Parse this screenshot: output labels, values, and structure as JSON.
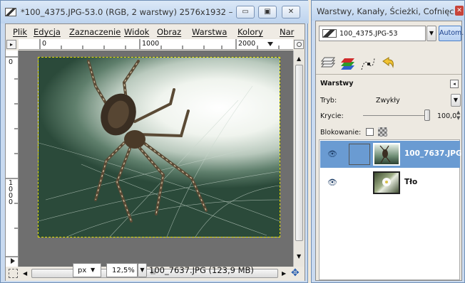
{
  "main_window": {
    "title": "*100_4375.JPG-53.0 (RGB, 2 warstwy) 2576x1932 – ...",
    "menu": [
      "Plik",
      "Edycja",
      "Zaznaczenie",
      "Widok",
      "Obraz",
      "Warstwa",
      "Kolory",
      "Nar"
    ],
    "ruler_top_labels": [
      "0",
      "1000",
      "2000"
    ],
    "ruler_left_labels": [
      "0",
      "1000"
    ],
    "hscroll_mark": "III",
    "unit": "px",
    "zoom": "12,5%",
    "status": "100_7637.JPG (123,9 MB)"
  },
  "layers_panel": {
    "title": "Warstwy, Kanały, Ścieżki, Cofnięc...",
    "image_select": "100_4375.JPG-53",
    "auto_button": "Autom.",
    "section_title": "Warstwy",
    "mode_label": "Tryb:",
    "mode_value": "Zwykły",
    "opacity_label": "Krycie:",
    "opacity_value": "100,0",
    "opacity_fraction": 1.0,
    "lock_label": "Blokowanie:",
    "layers": [
      {
        "name": "100_7637.JPG",
        "selected": true,
        "visible": true
      },
      {
        "name": "Tło",
        "selected": false,
        "visible": true
      }
    ]
  },
  "colors": {
    "selection": "#6a9bd2",
    "titlebar": "#c9daf0",
    "window_bg": "#ede9e1"
  },
  "icons": [
    "image-thumb-icon",
    "minimize-icon",
    "maximize-icon",
    "close-icon",
    "navigate-icon",
    "quickmask-icon",
    "layers-tab-icon",
    "channels-tab-icon",
    "paths-tab-icon",
    "undo-tab-icon",
    "eye-icon",
    "chain-icon",
    "panel-menu-icon"
  ]
}
